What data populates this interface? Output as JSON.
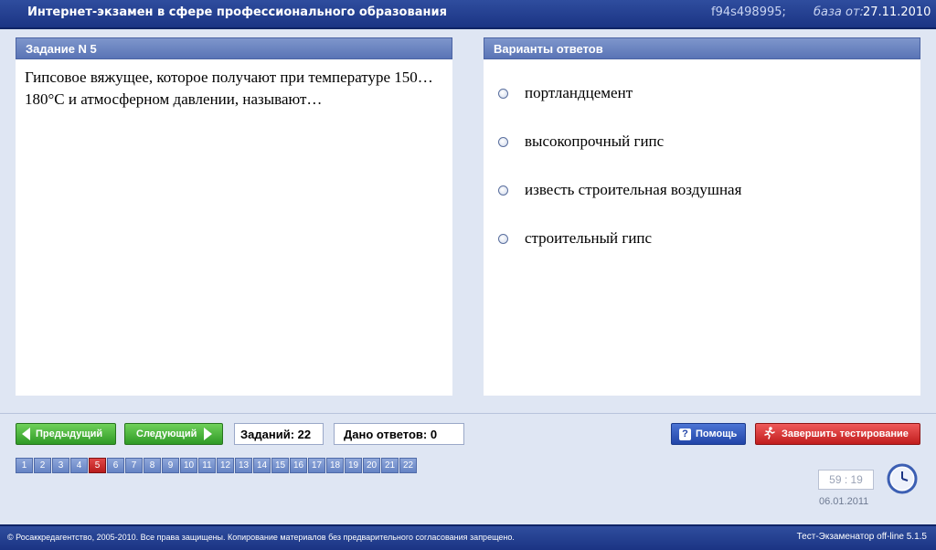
{
  "window": {
    "title": "Интернет-экзамен в сфере профессионального образования",
    "code": "f94s498995;",
    "base_label": "база от:",
    "base_date": "27.11.2010"
  },
  "task": {
    "header": "Задание N 5",
    "question": "Гипсовое вяжущее, которое получают при температуре 150…180°С  и атмосферном давлении, называют…"
  },
  "answers": {
    "header": "Варианты ответов",
    "options": [
      "портландцемент",
      "высокопрочный гипс",
      "известь строительная воздушная",
      "строительный гипс"
    ]
  },
  "nav": {
    "prev_label": "Предыдущий",
    "next_label": "Следующий",
    "tasks_count": "Заданий: 22",
    "answers_given": "Дано ответов: 0",
    "help_label": "Помощь",
    "finish_label": "Завершить тестирование"
  },
  "pages": [
    "1",
    "2",
    "3",
    "4",
    "5",
    "6",
    "7",
    "8",
    "9",
    "10",
    "11",
    "12",
    "13",
    "14",
    "15",
    "16",
    "17",
    "18",
    "19",
    "20",
    "21",
    "22"
  ],
  "active_page": "5",
  "timer": "59 : 19",
  "date": "06.01.2011",
  "footer": {
    "copyright": "© Росаккредагентство, 2005-2010. Все права защищены. Копирование материалов без предварительного согласования запрещено.",
    "version": "Тест-Экзаменатор off-line 5.1.5"
  },
  "colors": {
    "accent": "#1b3484",
    "active_page": "#c62828",
    "green_button": "#2f9a26",
    "red_button": "#c11d1d"
  },
  "icons": {
    "prev": "arrow-left-icon",
    "next": "arrow-right-icon",
    "help": "question-icon",
    "finish": "running-man-icon",
    "clock": "clock-icon"
  }
}
